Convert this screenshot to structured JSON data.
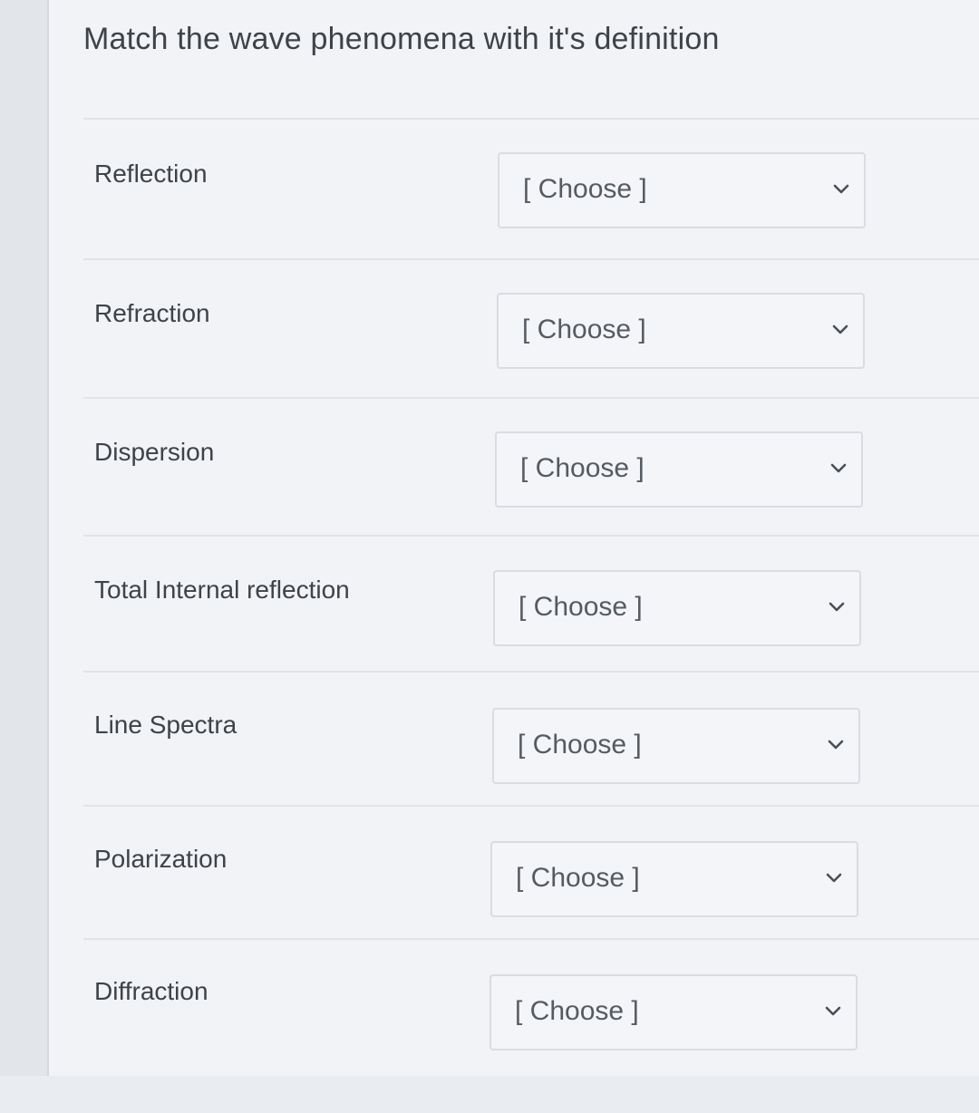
{
  "question": {
    "title": "Match the wave phenomena with it's definition"
  },
  "matches": [
    {
      "prompt": "Reflection",
      "selected": "[ Choose ]"
    },
    {
      "prompt": "Refraction",
      "selected": "[ Choose ]"
    },
    {
      "prompt": "Dispersion",
      "selected": "[ Choose ]"
    },
    {
      "prompt": "Total Internal reflection",
      "selected": "[ Choose ]"
    },
    {
      "prompt": "Line Spectra",
      "selected": "[ Choose ]"
    },
    {
      "prompt": "Polarization",
      "selected": "[ Choose ]"
    },
    {
      "prompt": "Diffraction",
      "selected": "[ Choose ]"
    }
  ],
  "icons": {
    "dropdown": "chevron-down-icon"
  },
  "colors": {
    "text": "#3e4349",
    "select_border": "#d9dde2",
    "background": "#f1f3f6"
  }
}
